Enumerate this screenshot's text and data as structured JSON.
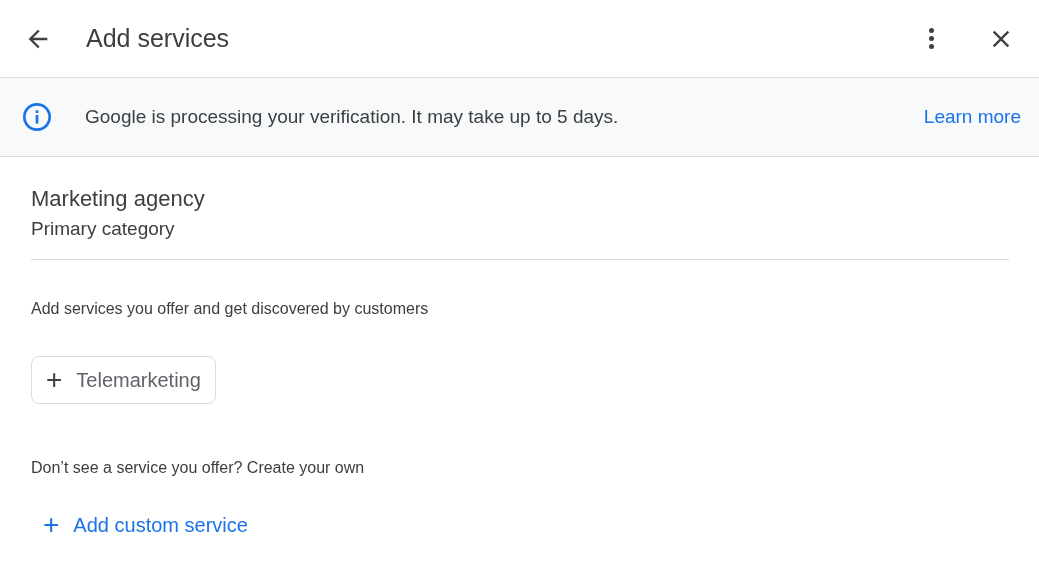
{
  "header": {
    "title": "Add services"
  },
  "banner": {
    "message": "Google is processing your verification. It may take up to 5 days.",
    "link": "Learn more"
  },
  "category": {
    "name": "Marketing agency",
    "label": "Primary category"
  },
  "services_prompt": "Add services you offer and get discovered by customers",
  "suggested_services": [
    {
      "label": "Telemarketing",
      "icon": "+"
    }
  ],
  "custom_prompt": "Don’t see a service you offer? Create your own",
  "custom_button": {
    "label": "Add custom service",
    "icon": "+"
  }
}
